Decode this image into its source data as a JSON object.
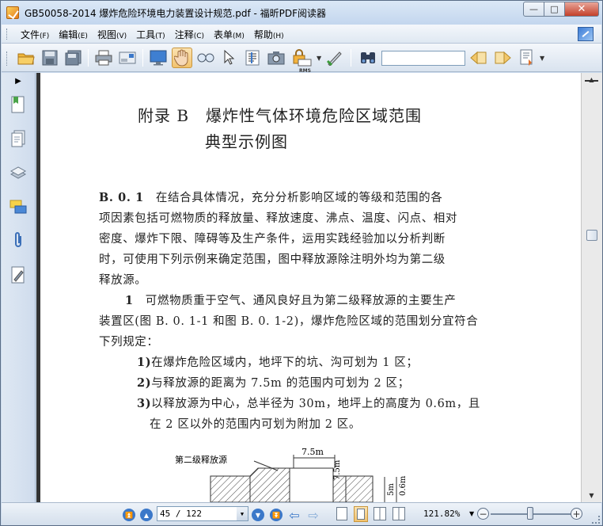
{
  "window": {
    "title": "GB50058-2014 爆炸危险环境电力装置设计规范.pdf - 福昕PDF阅读器",
    "controls": {
      "minimize": "—",
      "maximize": "□",
      "close": "✕"
    }
  },
  "menu": {
    "items": [
      {
        "label": "文件",
        "accel": "(F)"
      },
      {
        "label": "编辑",
        "accel": "(E)"
      },
      {
        "label": "视图",
        "accel": "(V)"
      },
      {
        "label": "工具",
        "accel": "(T)"
      },
      {
        "label": "注释",
        "accel": "(C)"
      },
      {
        "label": "表单",
        "accel": "(M)"
      },
      {
        "label": "帮助",
        "accel": "(H)"
      }
    ]
  },
  "toolbar": {
    "find_value": "",
    "rms_label": "RMS"
  },
  "document": {
    "title_line1": "附录 B　爆炸性气体环境危险区域范围",
    "title_line2": "典型示例图",
    "clause_label": "B. 0. 1",
    "p1_line1": "　在结合具体情况，充分分析影响区域的等级和范围的各",
    "p1_line2": "项因素包括可燃物质的释放量、释放速度、沸点、温度、闪点、相对",
    "p1_line3": "密度、爆炸下限、障碍等及生产条件，运用实践经验加以分析判断",
    "p1_line4": "时，可使用下列示例来确定范围，图中释放源除注明外均为第二级",
    "p1_line5": "释放源。",
    "item1_num": "1",
    "item1_line1": "　可燃物质重于空气、通风良好且为第二级释放源的主要生产",
    "item1_line2": "装置区(图 B. 0. 1-1 和图 B. 0. 1-2)，爆炸危险区域的范围划分宜符合",
    "item1_line3": "下列规定：",
    "sub1_num": "1)",
    "sub1_text": "在爆炸危险区域内，地坪下的坑、沟可划为 1 区；",
    "sub2_num": "2)",
    "sub2_text": "与释放源的距离为 7.5m 的范围内可划为 2 区；",
    "sub3_num": "3)",
    "sub3_text1": "以释放源为中心，总半径为 30m，地坪上的高度为 0.6m，且",
    "sub3_text2": "在 2 区以外的范围内可划为附加 2 区。",
    "figure": {
      "source_label": "第二级释放源",
      "dim_top": "7.5m",
      "dim_side": "7.5m",
      "dim_right1": "5m",
      "dim_right2": "0.6m"
    }
  },
  "status": {
    "page_field": "45 / 122",
    "zoom": "121.82%"
  }
}
